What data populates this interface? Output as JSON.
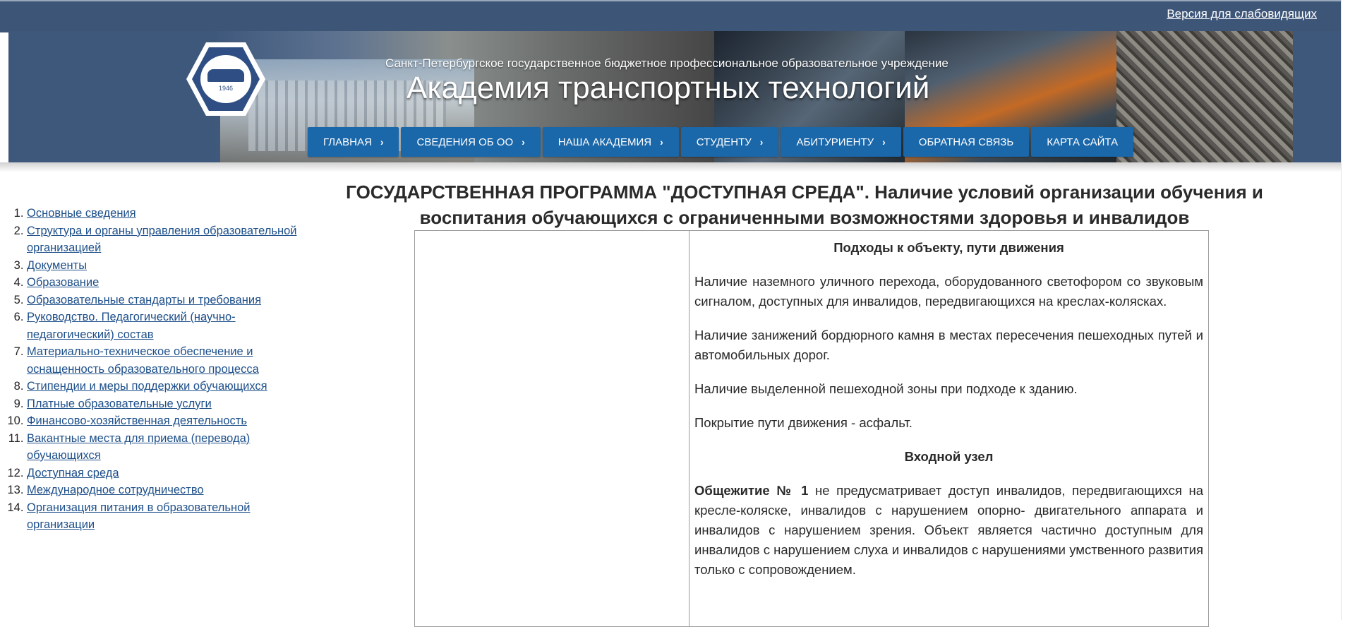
{
  "topbar": {
    "vision_link": "Версия для слабовидящих"
  },
  "header": {
    "subtitle": "Санкт-Петербургское государственное бюджетное профессиональное образовательное учреждение",
    "title": "Академия транспортных технологий",
    "logo_year": "1946"
  },
  "nav": {
    "items": [
      {
        "label": "ГЛАВНАЯ",
        "chevron": "›"
      },
      {
        "label": "СВЕДЕНИЯ ОБ ОО",
        "chevron": "›"
      },
      {
        "label": "НАША АКАДЕМИЯ",
        "chevron": "›"
      },
      {
        "label": "СТУДЕНТУ",
        "chevron": "›"
      },
      {
        "label": "АБИТУРИЕНТУ",
        "chevron": "›"
      },
      {
        "label": "ОБРАТНАЯ СВЯЗЬ"
      },
      {
        "label": "КАРТА САЙТА"
      }
    ]
  },
  "sidebar": {
    "items": [
      "Основные сведения",
      "Структура и органы управления образовательной организацией",
      "Документы",
      "Образование",
      "Образовательные стандарты и требования",
      "Руководство. Педагогический (научно-педагогический) состав",
      "Материально-техническое обеспечение и оснащенность образовательного процесса",
      "Стипендии и меры поддержки обучающихся",
      "Платные образовательные услуги",
      "Финансово-хозяйственная деятельность",
      "Вакантные места для приема (перевода) обучающихся",
      "Доступная среда",
      "Международное сотрудничество",
      "Организация питания в образовательной организации"
    ]
  },
  "main": {
    "heading": "ГОСУДАРСТВЕННАЯ ПРОГРАММА \"ДОСТУПНАЯ СРЕДА\". Наличие условий организации обучения и воспитания обучающихся с ограниченными возможностями здоровья и инвалидов",
    "section1_title": "Подходы к объекту, пути движения",
    "p1": "Наличие наземного уличного перехода, оборудованного светофором со звуковым сигналом, доступных для инвалидов, передвигающихся на креслах-колясках.",
    "p2": "Наличие занижений бордюрного камня в местах пересечения пешеходных путей и автомобильных дорог.",
    "p3": "Наличие выделенной пешеходной зоны при подходе к зданию.",
    "p4": "Покрытие пути движения - асфальт.",
    "section2_title": "Входной узел",
    "p5_bold": "Общежитие № 1",
    "p5_rest": " не предусматривает доступ инвалидов, передвигающихся на кресле-коляске, инвалидов с нарушением опорно- двигательного аппарата и инвалидов с нарушением зрения. Объект является частично доступным для инвалидов с нарушением слуха и инвалидов с нарушениями умственного развития только с сопровождением."
  }
}
